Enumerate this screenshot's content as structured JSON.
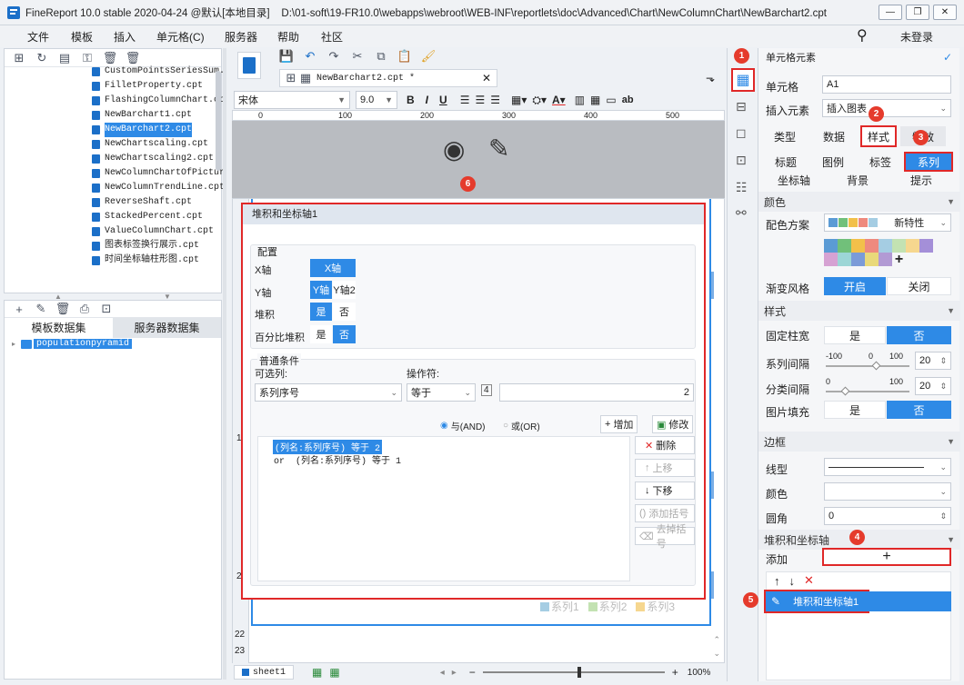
{
  "titlebar": {
    "title": "FineReport 10.0 stable 2020-04-24 @默认[本地目录]    D:\\01-soft\\19-FR10.0\\webapps\\webroot\\WEB-INF\\reportlets\\doc\\Advanced\\Chart\\NewColumnChart\\NewBarchart2.cpt",
    "min": "—",
    "max": "❐",
    "close": "✕"
  },
  "menu": {
    "items": [
      "文件",
      "模板",
      "插入",
      "单元格(C)",
      "服务器",
      "帮助",
      "社区"
    ],
    "login": "未登录"
  },
  "filetree": {
    "items": [
      "CustomPointsSeriesSum.",
      "FilletProperty.cpt",
      "FlashingColumnChart.cp",
      "NewBarchart1.cpt",
      "NewBarchart2.cpt",
      "NewChartscaling.cpt",
      "NewChartscaling2.cpt",
      "NewColumnChartOfPictur",
      "NewColumnTrendLine.cpt",
      "ReverseShaft.cpt",
      "StackedPercent.cpt",
      "ValueColumnChart.cpt",
      "图表标签换行展示.cpt",
      "时间坐标轴柱形图.cpt"
    ]
  },
  "datasets": {
    "tab1": "模板数据集",
    "tab2": "服务器数据集",
    "item": "populationpyramid"
  },
  "editor": {
    "tab_name": "NewBarchart2.cpt *",
    "font": "宋体",
    "size": "9.0",
    "ruler": [
      "0",
      "100",
      "200",
      "300",
      "400",
      "500"
    ],
    "rows": [
      "1",
      "2",
      "22",
      "23"
    ],
    "sheet": "sheet1",
    "zoom": "100%",
    "legend": [
      "系列1",
      "系列2",
      "系列3"
    ]
  },
  "dialog": {
    "title": "堆积和坐标轴1",
    "config_title": "配置",
    "x_axis_label": "X轴",
    "x_axis_value": "X轴",
    "y_axis_label": "Y轴",
    "y_axis_opt1": "Y轴",
    "y_axis_opt2": "Y轴2",
    "stack_label": "堆积",
    "pct_label": "百分比堆积",
    "yes": "是",
    "no": "否",
    "cond_title": "普通条件",
    "col_label": "可选列:",
    "op_label": "操作符:",
    "col_value": "系列序号",
    "op_value": "等于",
    "num_value": "2",
    "and_label": "与(AND)",
    "or_label": "或(OR)",
    "add_btn": "增加",
    "edit_btn": "修改",
    "del_btn": "删除",
    "up_btn": "上移",
    "down_btn": "下移",
    "addparen_btn": "添加括号",
    "rmparen_btn": "去掉括号",
    "cond1": "(列名:系列序号) 等于 2",
    "cond2": "or  (列名:系列序号) 等于 1"
  },
  "rightpanel": {
    "header": "单元格元素",
    "cell_label": "单元格",
    "cell_value": "A1",
    "insert_label": "插入元素",
    "insert_value": "插入图表",
    "tabs": [
      "类型",
      "数据",
      "样式",
      "特效"
    ],
    "subtabs": [
      "标题",
      "图例",
      "标签",
      "系列"
    ],
    "subtabs2": [
      "坐标轴",
      "背景",
      "提示"
    ],
    "color_section": "颜色",
    "scheme_label": "配色方案",
    "scheme_value": "新特性",
    "gradient_label": "渐变风格",
    "on": "开启",
    "off": "关闭",
    "style_section": "样式",
    "fixed_width_label": "固定柱宽",
    "series_gap_label": "系列间隔",
    "series_gap_value": "20",
    "cat_gap_label": "分类间隔",
    "cat_gap_value": "20",
    "img_fill_label": "图片填充",
    "yes": "是",
    "no": "否",
    "slider_min1": "-100",
    "slider_mid1": "0",
    "slider_max1": "100",
    "slider_min2": "0",
    "slider_max2": "100",
    "border_section": "边框",
    "line_label": "线型",
    "color_label": "颜色",
    "radius_label": "圆角",
    "radius_value": "0",
    "stack_section": "堆积和坐标轴",
    "add_label": "添加",
    "stack_item": "堆积和坐标轴1"
  },
  "badges": [
    "1",
    "2",
    "3",
    "4",
    "5",
    "6"
  ],
  "colors": {
    "accent": "#2e8ae6",
    "red": "#e02828",
    "palette": [
      "#5b9bd5",
      "#71c07a",
      "#f2c04a",
      "#ee8a7e",
      "#a5cde3",
      "#c3e2b2",
      "#f6d78f",
      "#a48fd8",
      "#d6a2d3",
      "#9cd6d6",
      "#7b9bd8",
      "#e9d97a",
      "#b29ad4"
    ]
  }
}
